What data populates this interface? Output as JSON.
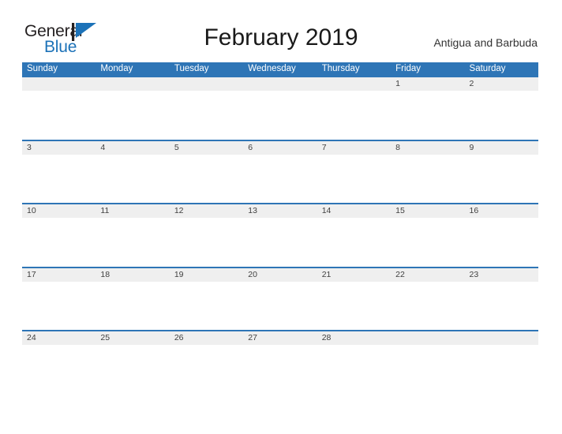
{
  "brand": {
    "name_part1": "General",
    "name_part2": "Blue",
    "flag_icon": "blue-triangle-flag-icon",
    "color_primary": "#1c72b8",
    "color_text": "#231f20"
  },
  "header": {
    "title": "February 2019",
    "region": "Antigua and Barbuda"
  },
  "calendar": {
    "month": "February",
    "year": "2019",
    "header_color": "#2e75b6",
    "date_strip_color": "#efefef",
    "weekdays": [
      {
        "label": "Sunday"
      },
      {
        "label": "Monday"
      },
      {
        "label": "Tuesday"
      },
      {
        "label": "Wednesday"
      },
      {
        "label": "Thursday"
      },
      {
        "label": "Friday"
      },
      {
        "label": "Saturday"
      }
    ],
    "weeks": [
      {
        "days": [
          "",
          "",
          "",
          "",
          "",
          "1",
          "2"
        ]
      },
      {
        "days": [
          "3",
          "4",
          "5",
          "6",
          "7",
          "8",
          "9"
        ]
      },
      {
        "days": [
          "10",
          "11",
          "12",
          "13",
          "14",
          "15",
          "16"
        ]
      },
      {
        "days": [
          "17",
          "18",
          "19",
          "20",
          "21",
          "22",
          "23"
        ]
      },
      {
        "days": [
          "24",
          "25",
          "26",
          "27",
          "28",
          "",
          ""
        ]
      }
    ]
  }
}
